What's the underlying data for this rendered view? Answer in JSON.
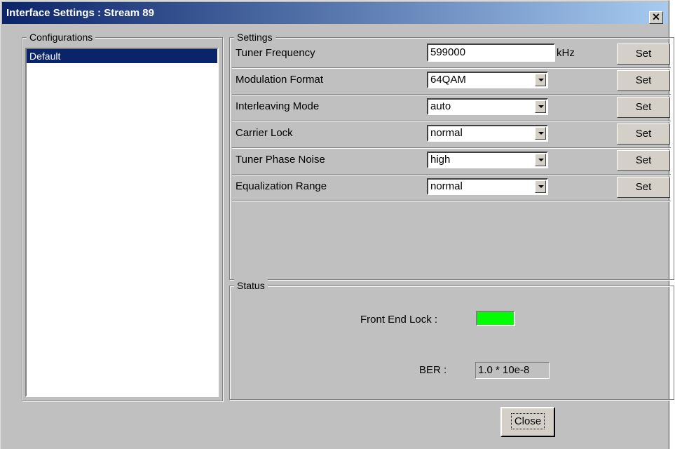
{
  "window": {
    "title": "Interface Settings : Stream 89",
    "close_glyph": "✕"
  },
  "configurations": {
    "legend": "Configurations",
    "items": [
      "Default"
    ],
    "selected": "Default"
  },
  "settings": {
    "legend": "Settings",
    "rows": [
      {
        "label": "Tuner Frequency",
        "control": "text",
        "value": "599000",
        "unit": "kHz",
        "button": "Set"
      },
      {
        "label": "Modulation Format",
        "control": "combo",
        "value": "64QAM",
        "button": "Set"
      },
      {
        "label": "Interleaving Mode",
        "control": "combo",
        "value": "auto",
        "button": "Set"
      },
      {
        "label": "Carrier Lock",
        "control": "combo",
        "value": "normal",
        "button": "Set"
      },
      {
        "label": "Tuner Phase Noise",
        "control": "combo",
        "value": "high",
        "button": "Set"
      },
      {
        "label": "Equalization Range",
        "control": "combo",
        "value": "normal",
        "button": "Set"
      }
    ]
  },
  "status": {
    "legend": "Status",
    "front_end_lock_label": "Front End Lock :",
    "front_end_lock_color": "#00ff00",
    "ber_label": "BER :",
    "ber_value": "1.0 * 10e-8"
  },
  "footer": {
    "close_label": "Close"
  },
  "colors": {
    "titlebar_start": "#0a246a",
    "titlebar_end": "#a6caf0",
    "selection": "#0a246a",
    "face": "#c0c0c0"
  }
}
